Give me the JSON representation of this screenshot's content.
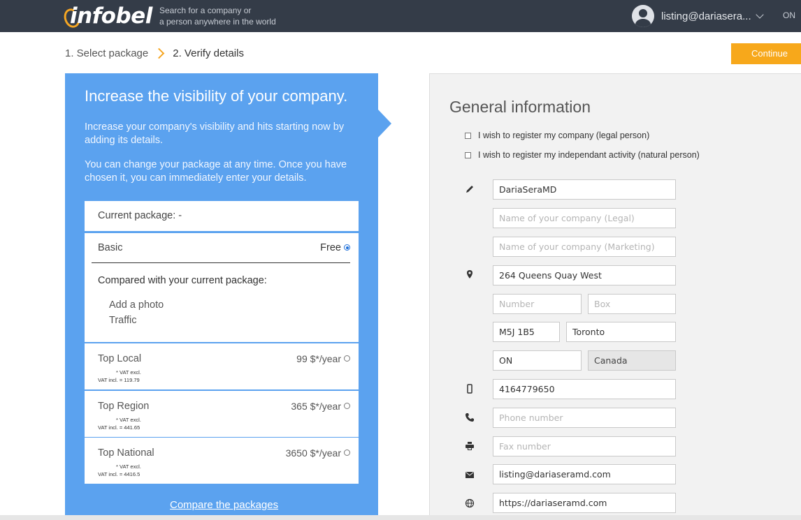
{
  "header": {
    "logo_text": "infobel",
    "tagline_line1": "Search for a company or",
    "tagline_line2": "a person anywhere in the world",
    "user_email": "listing@dariasera...",
    "region": "ON"
  },
  "breadcrumb": {
    "step1": "1. Select package",
    "step2": "2. Verify details"
  },
  "continue_label": "Continue",
  "left_panel": {
    "title": "Increase the visibility of your company.",
    "paragraph1": "Increase your company's visibility and hits starting now by adding its details.",
    "paragraph2": "You can change your package at any time. Once you have chosen it, you can immediately enter your details.",
    "current_package": "Current package: -",
    "basic": {
      "name": "Basic",
      "price": "Free",
      "compared": "Compared with your current package:",
      "features": [
        "Add a photo",
        "Traffic"
      ]
    },
    "tiers": [
      {
        "name": "Top Local",
        "price": "99 $*/year",
        "vat_excl": "* VAT excl.",
        "vat_incl": "VAT incl. = 119.79"
      },
      {
        "name": "Top Region",
        "price": "365 $*/year",
        "vat_excl": "* VAT excl.",
        "vat_incl": "VAT incl. = 441.65"
      },
      {
        "name": "Top National",
        "price": "3650 $*/year",
        "vat_excl": "* VAT excl.",
        "vat_incl": "VAT incl. = 4416.5"
      }
    ],
    "compare_link": "Compare the packages"
  },
  "right_panel": {
    "title": "General information",
    "checkbox_legal": "I wish to register my company (legal person)",
    "checkbox_natural": "I wish to register my independant activity (natural person)",
    "fields": {
      "name": {
        "value": "DariaSeraMD",
        "placeholder": ""
      },
      "company_legal": {
        "value": "",
        "placeholder": "Name of your company (Legal)"
      },
      "company_marketing": {
        "value": "",
        "placeholder": "Name of your company (Marketing)"
      },
      "street": {
        "value": "264 Queens Quay West",
        "placeholder": ""
      },
      "number": {
        "value": "",
        "placeholder": "Number"
      },
      "box": {
        "value": "",
        "placeholder": "Box"
      },
      "postal_code": {
        "value": "M5J 1B5",
        "placeholder": ""
      },
      "city": {
        "value": "Toronto",
        "placeholder": ""
      },
      "province": {
        "value": "ON",
        "placeholder": ""
      },
      "country": {
        "value": "Canada",
        "placeholder": ""
      },
      "mobile": {
        "value": "4164779650",
        "placeholder": ""
      },
      "phone": {
        "value": "",
        "placeholder": "Phone number"
      },
      "fax": {
        "value": "",
        "placeholder": "Fax number"
      },
      "email": {
        "value": "listing@dariaseramd.com",
        "placeholder": ""
      },
      "website": {
        "value": "https://dariaseramd.com",
        "placeholder": ""
      }
    }
  },
  "colors": {
    "topbar": "#343c48",
    "accent": "#f7a81b",
    "panel_blue": "#5ba2ef"
  }
}
